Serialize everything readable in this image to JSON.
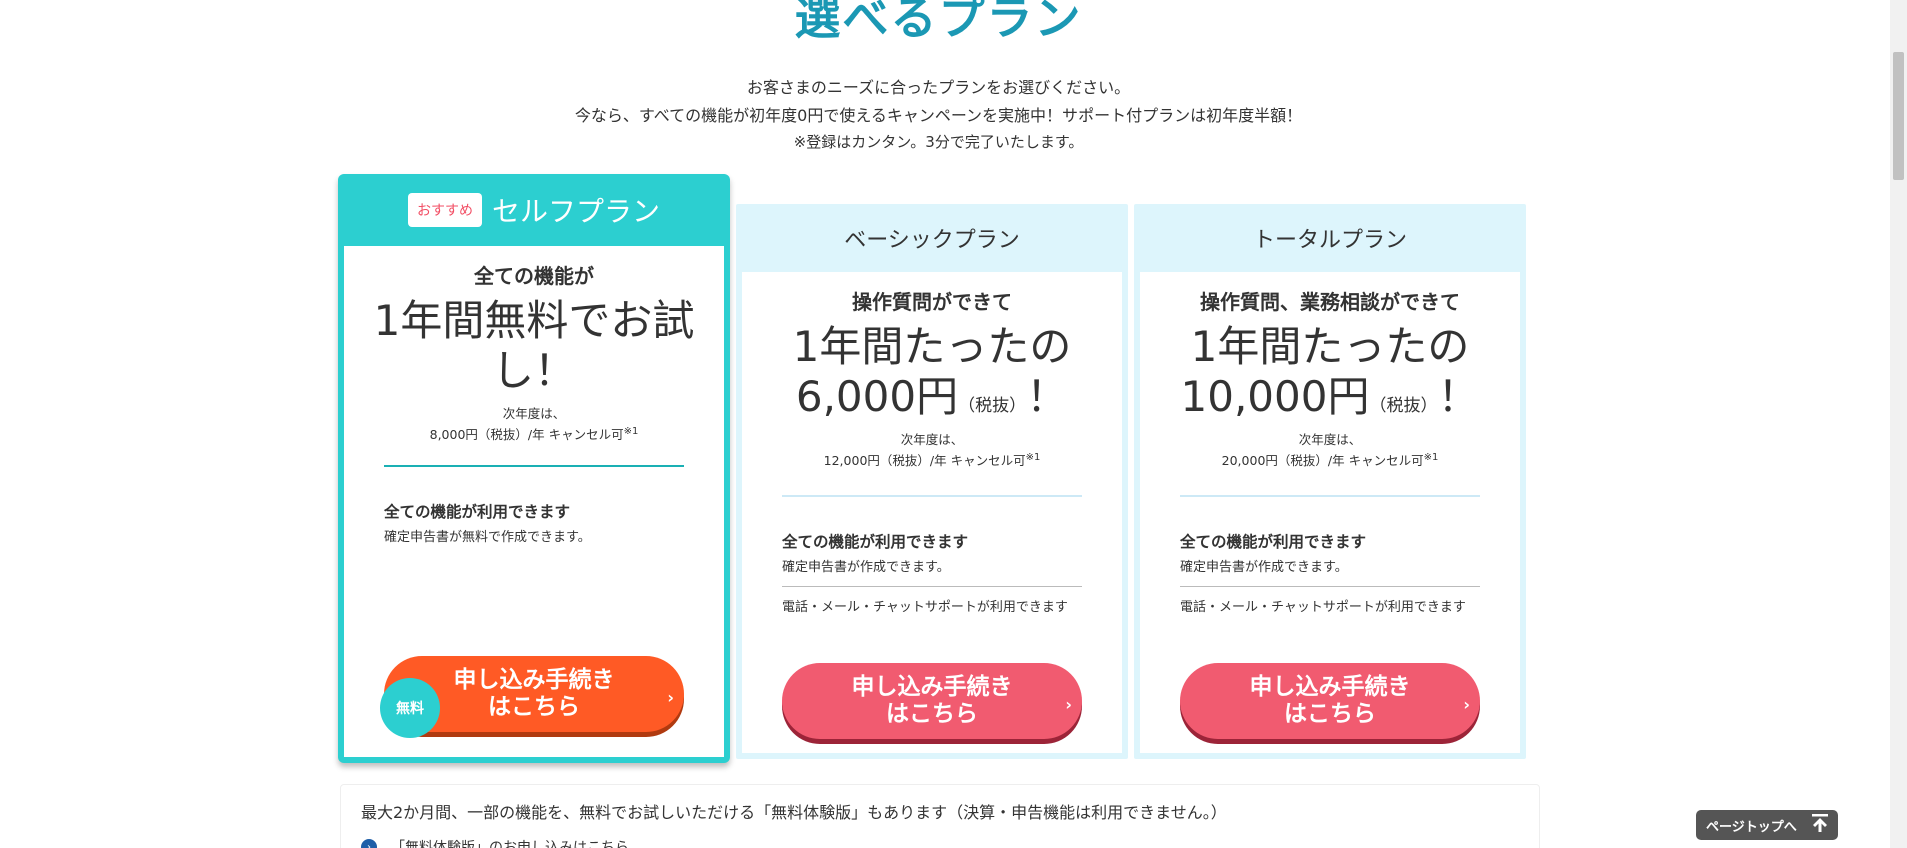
{
  "header": {
    "title": "選べるプラン",
    "intro_line1": "お客さまのニーズに合ったプランをお選びください。",
    "intro_line2": "今なら、すべての機能が初年度0円で使えるキャンペーンを実施中！サポート付プランは初年度半額！",
    "intro_line3": "※登録はカンタン。3分で完了いたします。"
  },
  "plans": [
    {
      "recommend_badge": "おすすめ",
      "name": "セルフプラン",
      "lead": "全ての機能が",
      "price_line1": "1年間無料でお試",
      "price_line2": "し！",
      "next_year_label": "次年度は、",
      "next_year_price": "8,000円（税抜）/年 キャンセル可",
      "next_year_note": "※1",
      "feature_title": "全ての機能が利用できます",
      "feature_desc": "確定申告書が無料で作成できます。",
      "free_badge": "無料",
      "cta_label": "申し込み手続き\nはこちら",
      "cta_arrow": "›",
      "accent_color": "#2ccfd0"
    },
    {
      "name": "ベーシックプラン",
      "lead": "操作質問ができて",
      "price_line1": "1年間たったの",
      "price_amount": "6,000円",
      "price_tax": "（税抜）",
      "price_exclaim": "！",
      "next_year_label": "次年度は、",
      "next_year_price": "12,000円（税抜）/年 キャンセル可",
      "next_year_note": "※1",
      "feature_title": "全ての機能が利用できます",
      "feature_desc": "確定申告書が作成できます。",
      "support_text": "電話・メール・チャットサポートが利用できます",
      "cta_label": "申し込み手続き\nはこちら",
      "cta_arrow": "›",
      "accent_color": "#ddf5fc"
    },
    {
      "name": "トータルプラン",
      "lead": "操作質問、業務相談ができて",
      "price_line1": "1年間たったの",
      "price_amount": "10,000円",
      "price_tax": "（税抜）",
      "price_exclaim": "！",
      "next_year_label": "次年度は、",
      "next_year_price": "20,000円（税抜）/年 キャンセル可",
      "next_year_note": "※1",
      "feature_title": "全ての機能が利用できます",
      "feature_desc": "確定申告書が作成できます。",
      "support_text": "電話・メール・チャットサポートが利用できます",
      "cta_label": "申し込み手続き\nはこちら",
      "cta_arrow": "›",
      "accent_color": "#ddf5fc"
    }
  ],
  "trial": {
    "text": "最大2か月間、一部の機能を、無料でお試しいただける「無料体験版」もあります（決算・申告機能は利用できません。）",
    "link_label": "「無料体験版」のお申し込みはこちら",
    "link_icon": "chevron-right-circle-icon"
  },
  "page_top": {
    "label": "ページトップへ",
    "icon": "arrow-up-icon"
  },
  "colors": {
    "title": "#1b98b4",
    "teal": "#2ccfd0",
    "free_cta": "#ff5a25",
    "paid_cta": "#f15b70",
    "light_blue": "#ddf5fc"
  }
}
